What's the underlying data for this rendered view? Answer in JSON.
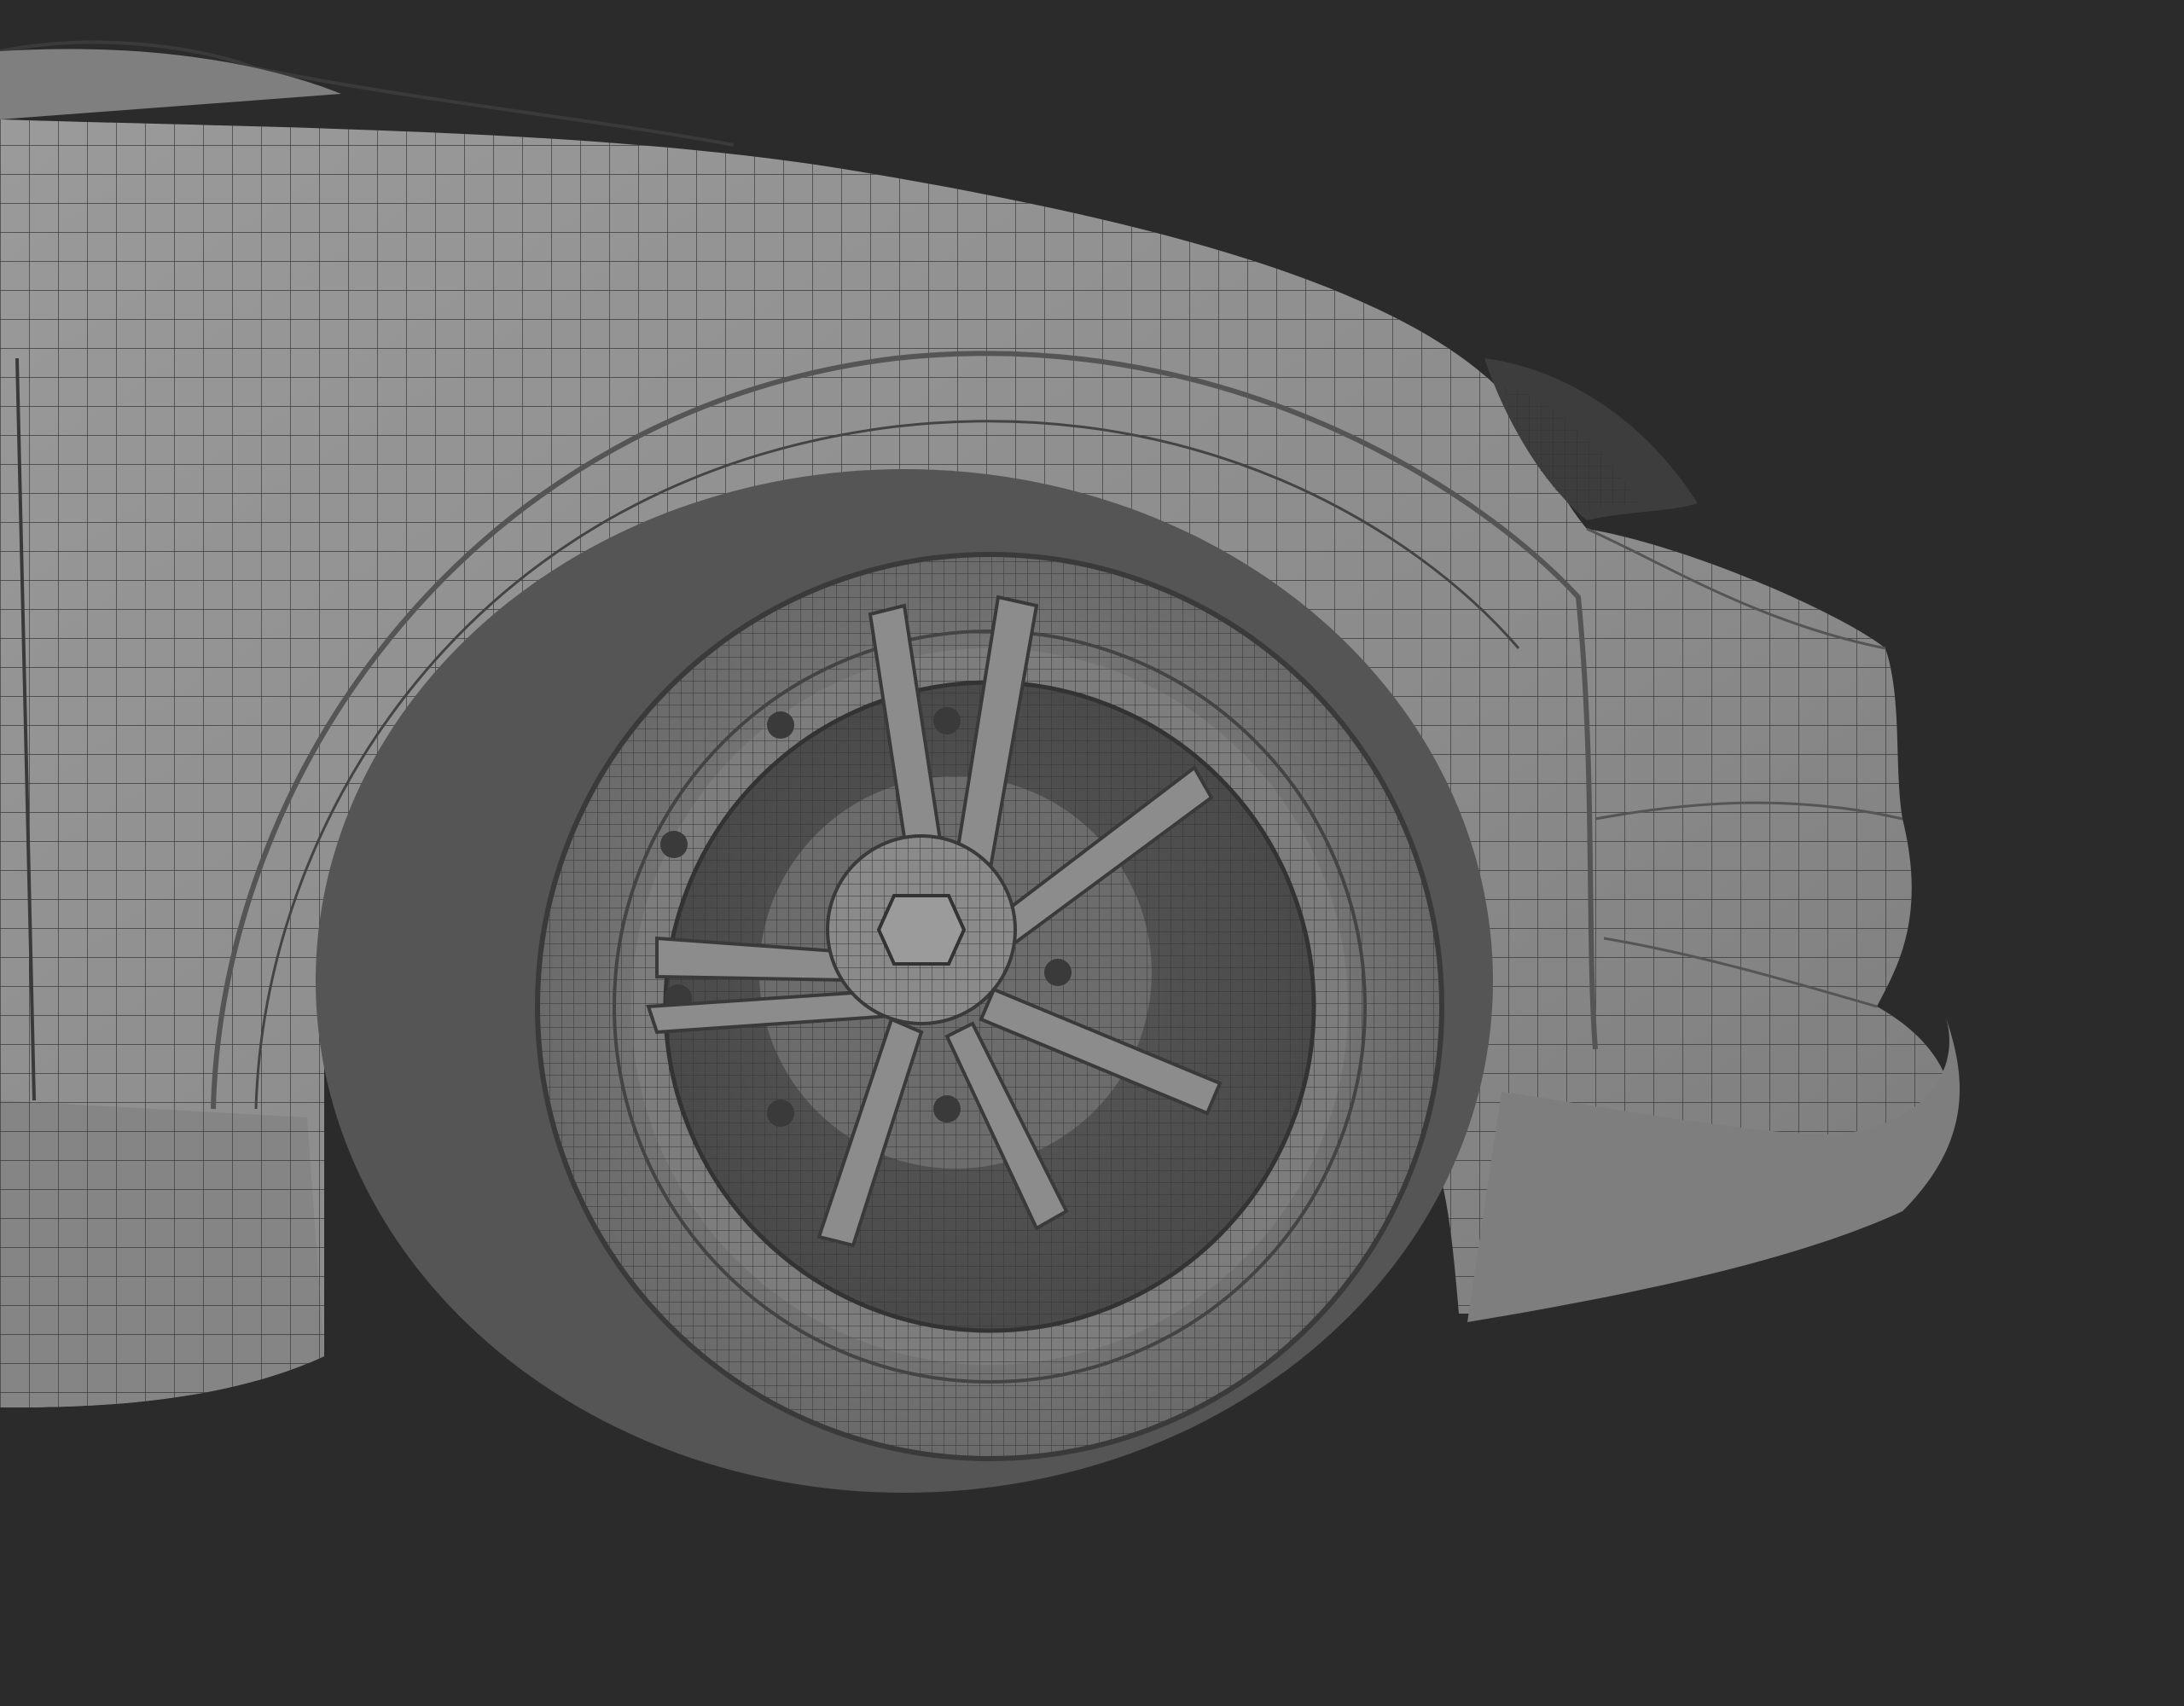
{
  "viewport": {
    "background": "#2b2b2b",
    "model_color": "#8a8a8a",
    "wire_color": "#2f2f2f"
  }
}
